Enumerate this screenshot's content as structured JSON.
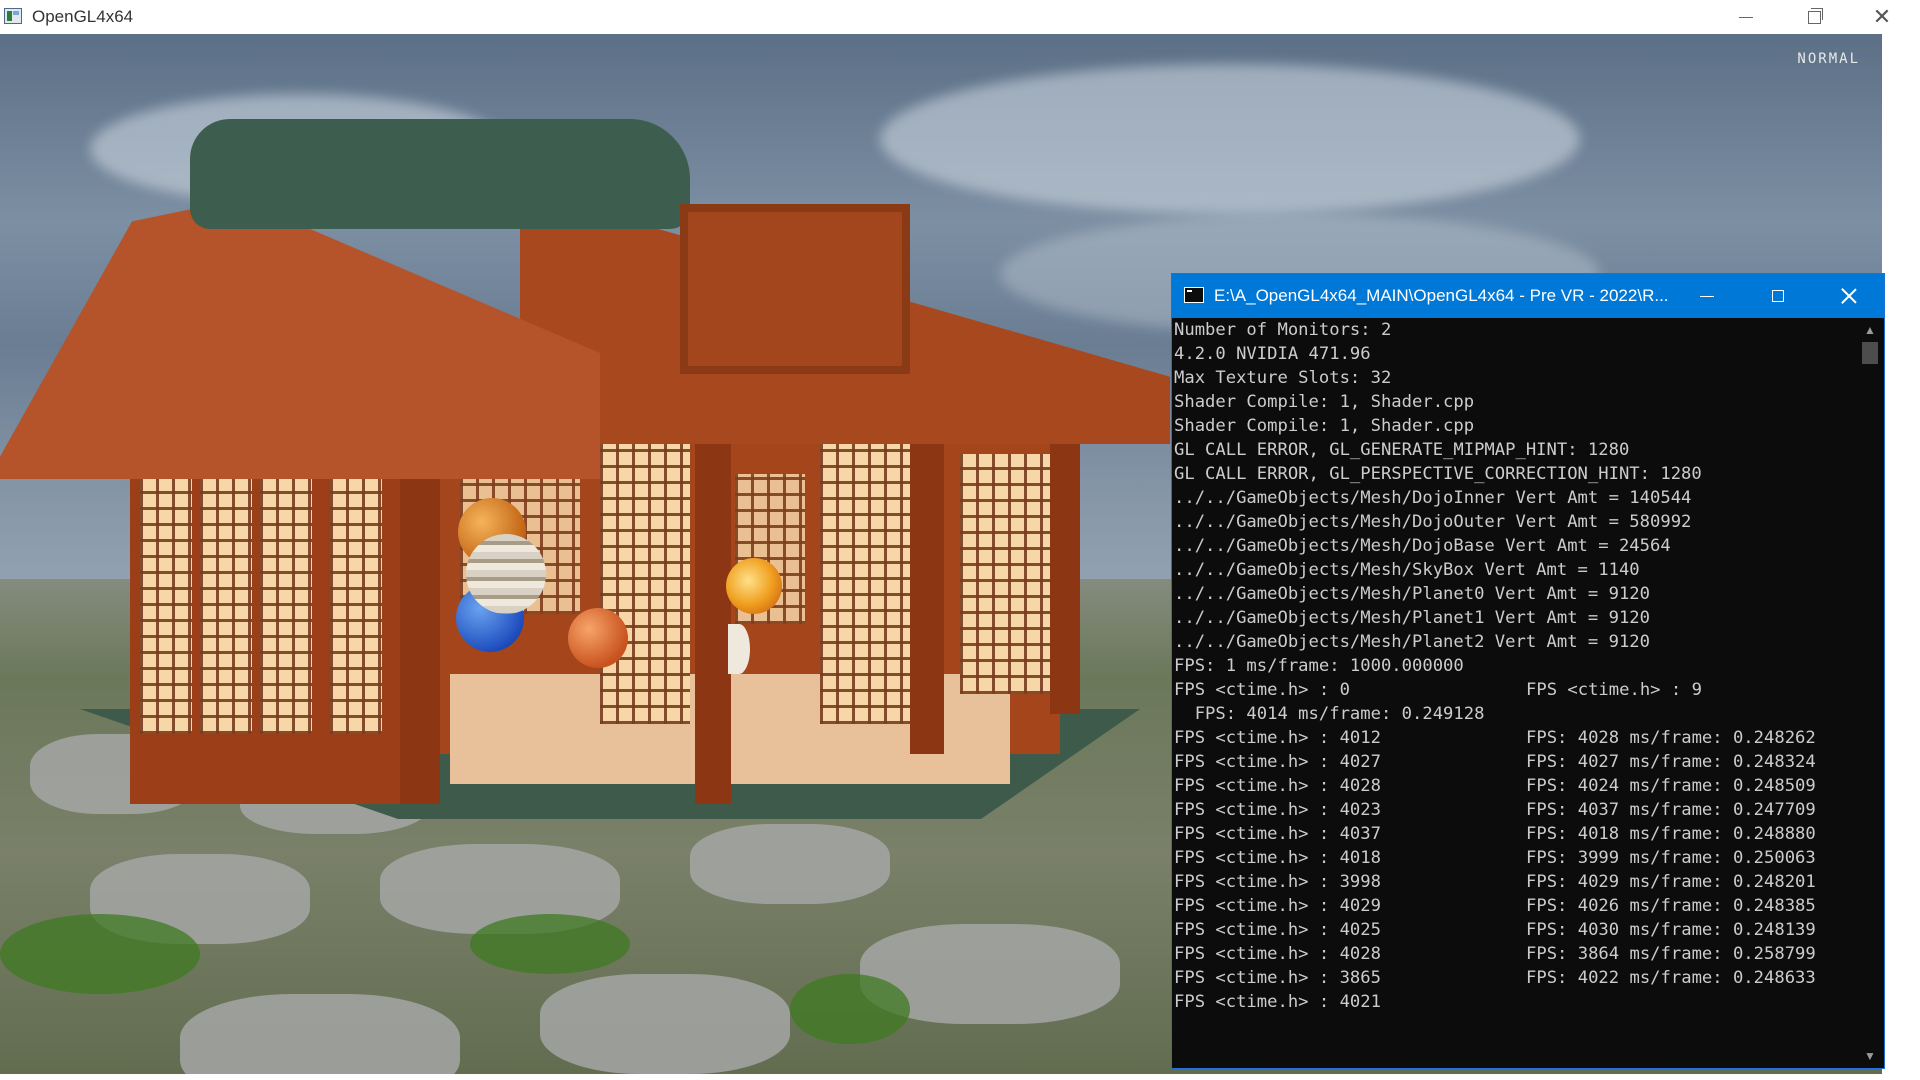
{
  "main_window": {
    "title": "OpenGL4x64",
    "mode_label": "NORMAL",
    "controls": {
      "minimize": "minimize-icon",
      "restore": "restore-icon",
      "close": "close-icon"
    }
  },
  "console": {
    "title": "E:\\A_OpenGL4x64_MAIN\\OpenGL4x64 - Pre VR - 2022\\R...",
    "lines": [
      "Number of Monitors: 2",
      "4.2.0 NVIDIA 471.96",
      "Max Texture Slots: 32",
      "Shader Compile: 1, Shader.cpp",
      "Shader Compile: 1, Shader.cpp",
      "GL CALL ERROR, GL_GENERATE_MIPMAP_HINT: 1280",
      "GL CALL ERROR, GL_PERSPECTIVE_CORRECTION_HINT: 1280",
      "../../GameObjects/Mesh/DojoInner Vert Amt = 140544",
      "../../GameObjects/Mesh/DojoOuter Vert Amt = 580992",
      "../../GameObjects/Mesh/DojoBase Vert Amt = 24564",
      "../../GameObjects/Mesh/SkyBox Vert Amt = 1140",
      "../../GameObjects/Mesh/Planet0 Vert Amt = 9120",
      "../../GameObjects/Mesh/Planet1 Vert Amt = 9120",
      "../../GameObjects/Mesh/Planet2 Vert Amt = 9120",
      "FPS: 1 ms/frame: 1000.000000"
    ],
    "fps_first_row": {
      "left": "FPS <ctime.h> : 0",
      "right": "FPS <ctime.h> : 9"
    },
    "fps_indented": "  FPS: 4014 ms/frame: 0.249128",
    "fps_rows": [
      {
        "left": "FPS <ctime.h> : 4012",
        "right": "FPS: 4028 ms/frame: 0.248262"
      },
      {
        "left": "FPS <ctime.h> : 4027",
        "right": "FPS: 4027 ms/frame: 0.248324"
      },
      {
        "left": "FPS <ctime.h> : 4028",
        "right": "FPS: 4024 ms/frame: 0.248509"
      },
      {
        "left": "FPS <ctime.h> : 4023",
        "right": "FPS: 4037 ms/frame: 0.247709"
      },
      {
        "left": "FPS <ctime.h> : 4037",
        "right": "FPS: 4018 ms/frame: 0.248880"
      },
      {
        "left": "FPS <ctime.h> : 4018",
        "right": "FPS: 3999 ms/frame: 0.250063"
      },
      {
        "left": "FPS <ctime.h> : 3998",
        "right": "FPS: 4029 ms/frame: 0.248201"
      },
      {
        "left": "FPS <ctime.h> : 4029",
        "right": "FPS: 4026 ms/frame: 0.248385"
      },
      {
        "left": "FPS <ctime.h> : 4025",
        "right": "FPS: 4030 ms/frame: 0.248139"
      },
      {
        "left": "FPS <ctime.h> : 4028",
        "right": "FPS: 3864 ms/frame: 0.258799"
      },
      {
        "left": "FPS <ctime.h> : 3865",
        "right": "FPS: 4022 ms/frame: 0.248633"
      },
      {
        "left": "FPS <ctime.h> : 4021",
        "right": ""
      }
    ],
    "scrollbar": {
      "up": "▲",
      "down": "▼"
    }
  },
  "colors": {
    "console_titlebar": "#0078d7",
    "console_bg": "#0c0c0c",
    "console_text": "#cccccc"
  }
}
